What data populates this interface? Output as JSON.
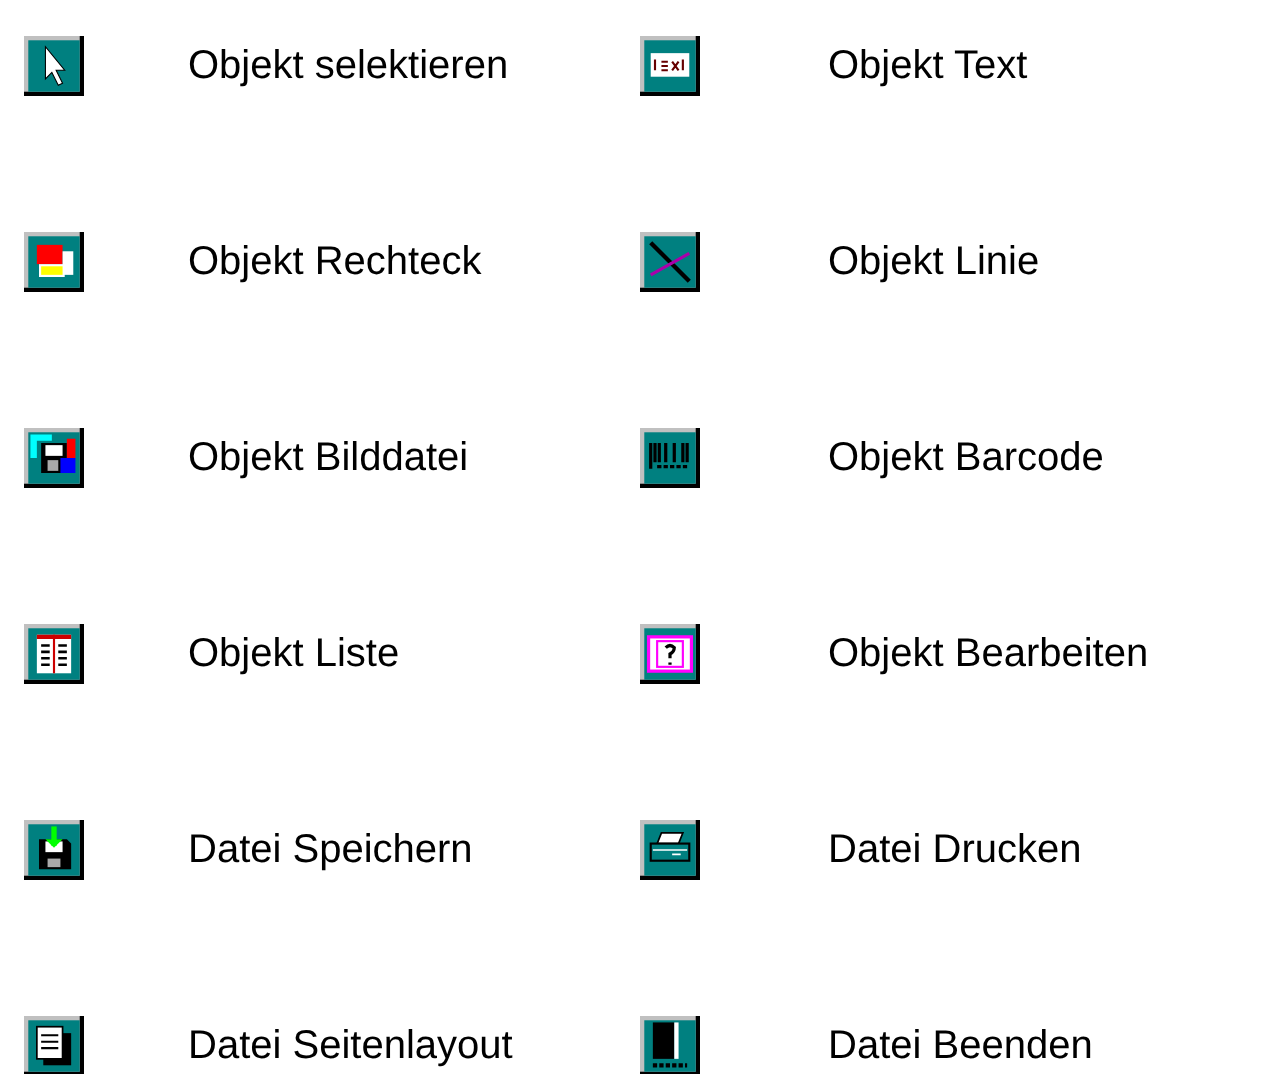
{
  "rows": [
    {
      "left": {
        "kind": "pointer",
        "label": "Objekt selektieren"
      },
      "right": {
        "kind": "text",
        "label": "Objekt Text"
      }
    },
    {
      "left": {
        "kind": "rectangle",
        "label": "Objekt Rechteck"
      },
      "right": {
        "kind": "line",
        "label": "Objekt Linie"
      }
    },
    {
      "left": {
        "kind": "image",
        "label": "Objekt Bilddatei"
      },
      "right": {
        "kind": "barcode",
        "label": "Objekt Barcode"
      }
    },
    {
      "left": {
        "kind": "list",
        "label": "Objekt Liste"
      },
      "right": {
        "kind": "edit",
        "label": "Objekt Bearbeiten"
      }
    },
    {
      "left": {
        "kind": "save",
        "label": "Datei Speichern"
      },
      "right": {
        "kind": "print",
        "label": "Datei Drucken"
      }
    },
    {
      "left": {
        "kind": "layout",
        "label": "Datei Seitenlayout"
      },
      "right": {
        "kind": "exit",
        "label": "Datei Beenden"
      }
    }
  ]
}
